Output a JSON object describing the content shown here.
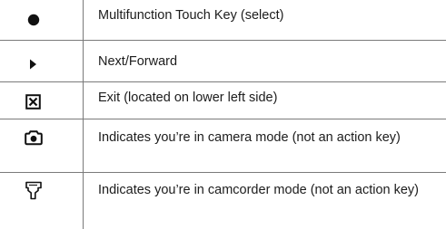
{
  "legend": {
    "rows": [
      {
        "icon": "filled-circle-icon",
        "description": "Multifunction Touch Key (select)"
      },
      {
        "icon": "right-triangle-arrow-icon",
        "description": "Next/Forward"
      },
      {
        "icon": "boxed-x-icon",
        "description": "Exit (located on lower left side)"
      },
      {
        "icon": "camera-icon",
        "description": "Indicates you’re in camera mode (not an action key)"
      },
      {
        "icon": "camcorder-icon",
        "description": "Indicates you’re in camcorder mode (not an action key)"
      }
    ]
  }
}
